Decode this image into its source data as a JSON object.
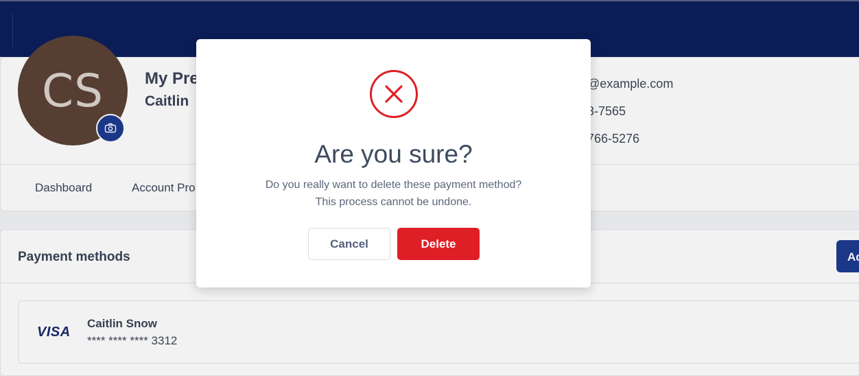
{
  "profile": {
    "avatar_initials": "CS",
    "heading": "My Pre",
    "name": "Caitlin",
    "contact": {
      "email": "@example.com",
      "phone1": "3-7565",
      "phone2": "766-5276"
    }
  },
  "tabs": [
    {
      "label": "Dashboard"
    },
    {
      "label": "Account Pro"
    }
  ],
  "payments": {
    "title": "Payment methods",
    "add_button_label": "Add",
    "items": [
      {
        "brand": "VISA",
        "holder": "Caitlin Snow",
        "number": "**** **** **** 3312"
      }
    ]
  },
  "modal": {
    "icon": "x-circle-icon",
    "title": "Are you sure?",
    "message_line1": "Do you really want to delete these payment method?",
    "message_line2": "This process cannot be undone.",
    "cancel_label": "Cancel",
    "delete_label": "Delete"
  },
  "colors": {
    "header": "#0c1f5c",
    "primary": "#1d3a8f",
    "danger": "#df1f26",
    "avatar_bg": "#5b4236"
  }
}
